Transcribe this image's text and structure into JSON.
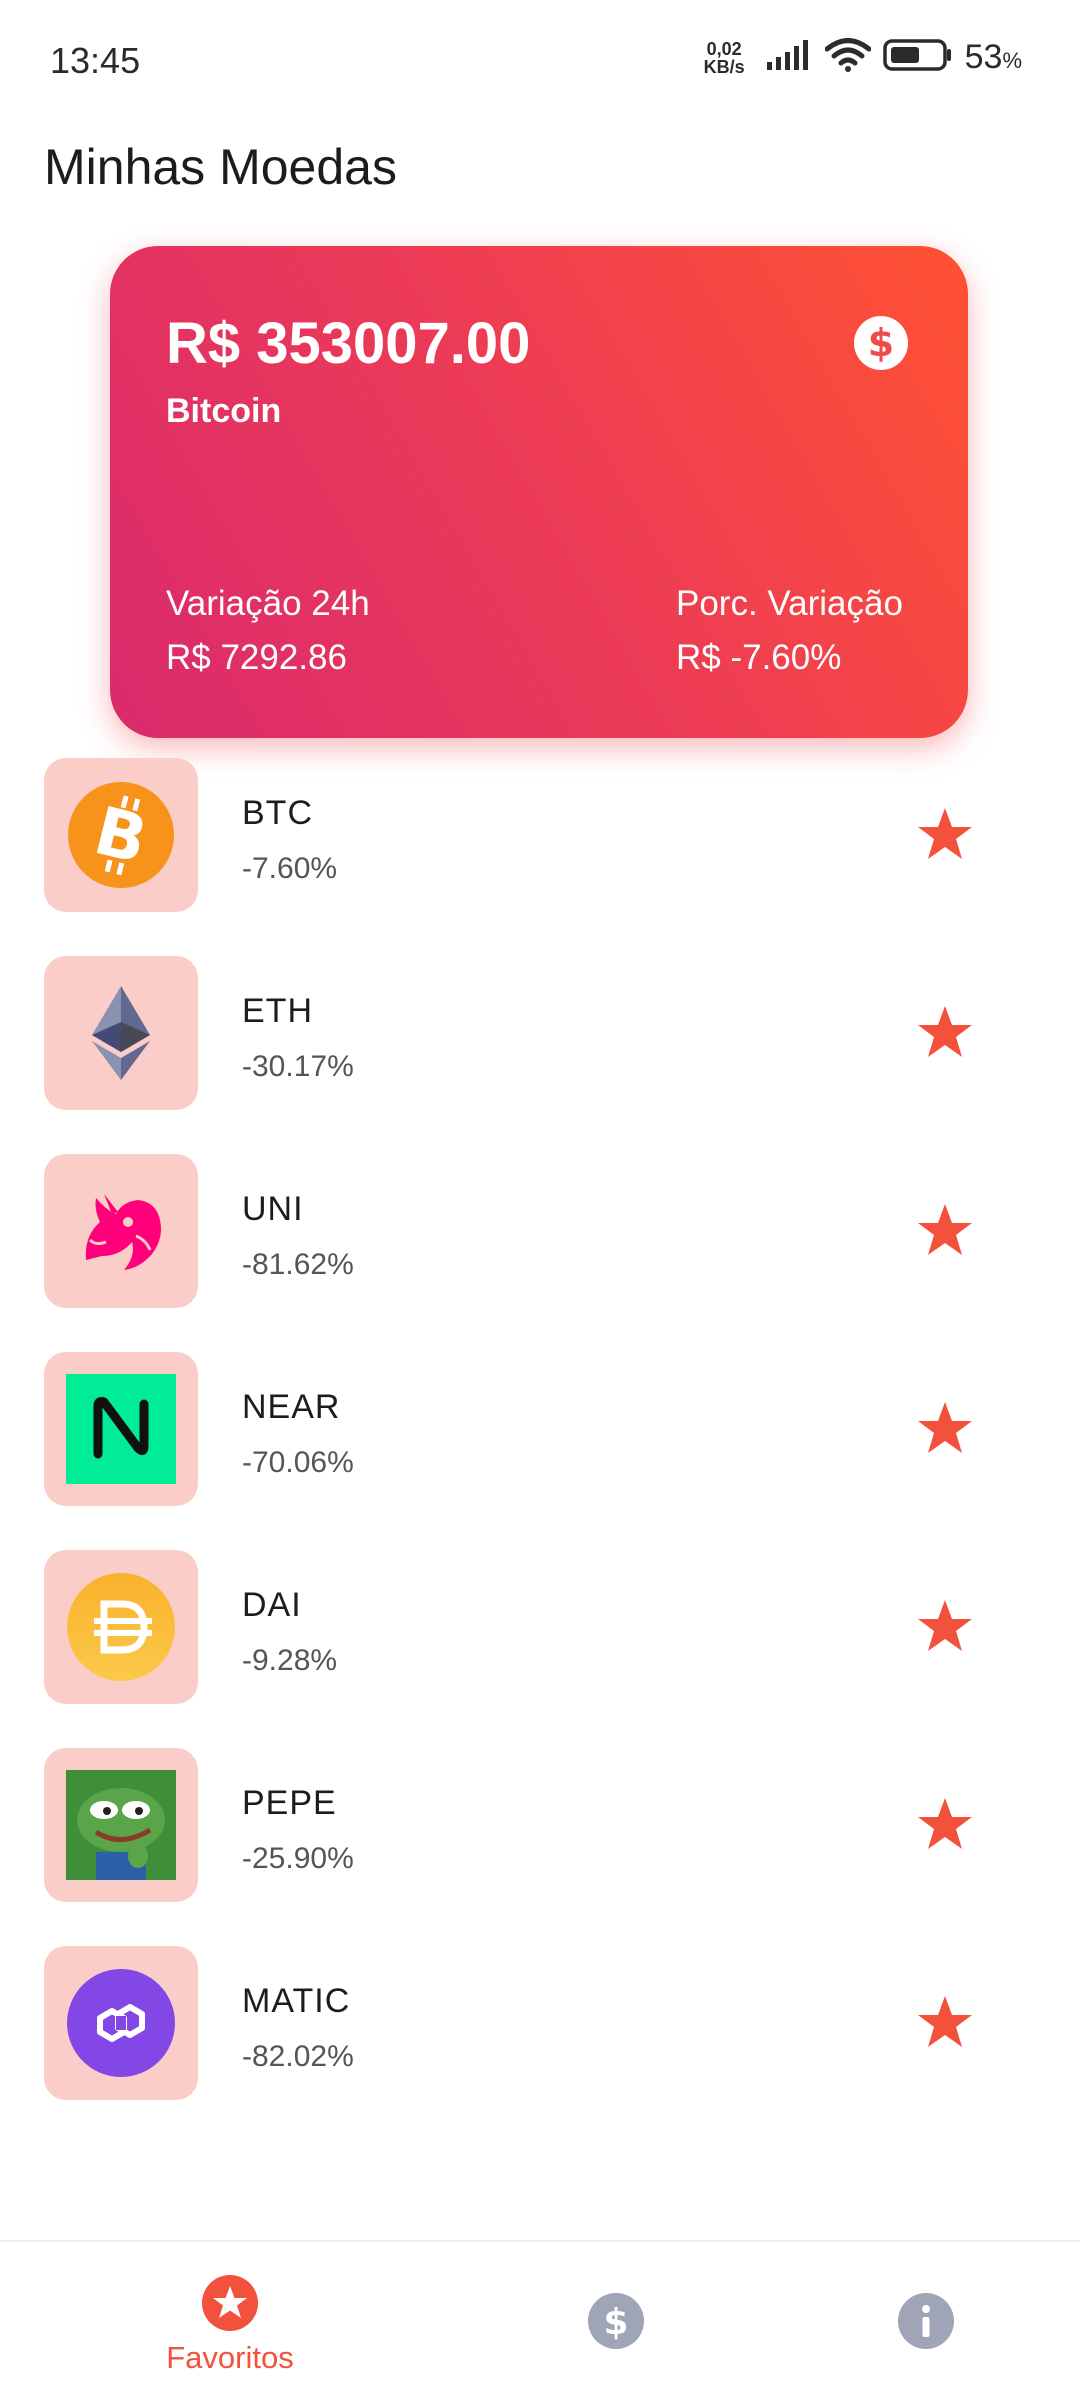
{
  "status_bar": {
    "time": "13:45",
    "net_speed_value": "0,02",
    "net_speed_unit": "KB/s",
    "battery_percent": "53",
    "battery_percent_sign": "%"
  },
  "header": {
    "title": "Minhas Moedas"
  },
  "hero": {
    "price": "R$ 353007.00",
    "name": "Bitcoin",
    "variation_label": "Variação 24h",
    "variation_value": "R$ 7292.86",
    "percent_label": "Porc. Variação",
    "percent_value": "R$ -7.60%",
    "icon": "dollar-circle-icon"
  },
  "coins": [
    {
      "symbol": "BTC",
      "change": "-7.60%",
      "logo": "bitcoin-logo"
    },
    {
      "symbol": "ETH",
      "change": "-30.17%",
      "logo": "ethereum-logo"
    },
    {
      "symbol": "UNI",
      "change": "-81.62%",
      "logo": "uniswap-logo"
    },
    {
      "symbol": "NEAR",
      "change": "-70.06%",
      "logo": "near-logo"
    },
    {
      "symbol": "DAI",
      "change": "-9.28%",
      "logo": "dai-logo"
    },
    {
      "symbol": "PEPE",
      "change": "-25.90%",
      "logo": "pepe-logo"
    },
    {
      "symbol": "MATIC",
      "change": "-82.02%",
      "logo": "polygon-logo"
    }
  ],
  "bottom_nav": {
    "favorites_label": "Favoritos",
    "items": [
      "star-icon",
      "dollar-icon",
      "info-icon"
    ]
  },
  "colors": {
    "accent": "#f2513c",
    "tile_bg": "#fbcdc8",
    "nav_inactive": "#9fa4b6",
    "card_gradient_start": "#da2a6d",
    "card_gradient_end": "#ff5232"
  }
}
